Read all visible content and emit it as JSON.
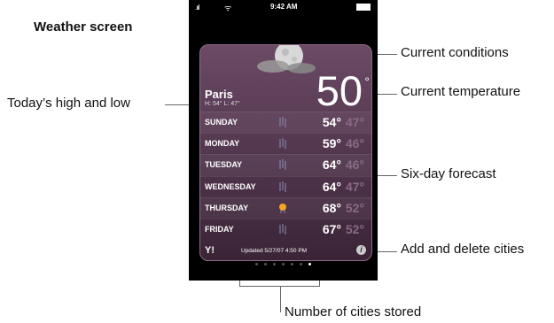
{
  "captions": {
    "weather_screen": "Weather screen",
    "todays_high_low": "Today’s high and low",
    "current_conditions": "Current conditions",
    "current_temperature": "Current temperature",
    "six_day_forecast": "Six-day forecast",
    "add_delete_cities": "Add and delete cities",
    "number_of_cities": "Number of cities stored"
  },
  "statusbar": {
    "signal": ".ııl",
    "wifi": "ᯤ",
    "time": "9:42 AM"
  },
  "weather": {
    "city": "Paris",
    "hilo": "H: 54° L: 47°",
    "current_temp": "50",
    "degree": "°",
    "forecast": [
      {
        "day": "SUNDAY",
        "high": "54°",
        "low": "47°",
        "icon": "rain-icon"
      },
      {
        "day": "MONDAY",
        "high": "59°",
        "low": "46°",
        "icon": "rain-icon"
      },
      {
        "day": "TUESDAY",
        "high": "64°",
        "low": "46°",
        "icon": "rain-icon"
      },
      {
        "day": "WEDNESDAY",
        "high": "64°",
        "low": "47°",
        "icon": "rain-icon"
      },
      {
        "day": "THURSDAY",
        "high": "68°",
        "low": "52°",
        "icon": "sun-cloud-icon"
      },
      {
        "day": "FRIDAY",
        "high": "67°",
        "low": "52°",
        "icon": "rain-icon"
      }
    ],
    "yahoo": "Y!",
    "updated": "Updated 5/27/07 4:50 PM",
    "info": "i"
  },
  "pages": {
    "count": 7,
    "active_index": 6
  },
  "colors": {
    "card_top": "#6b4a66",
    "card_bottom": "#3a2436",
    "low_temp": "#8a6a85"
  }
}
